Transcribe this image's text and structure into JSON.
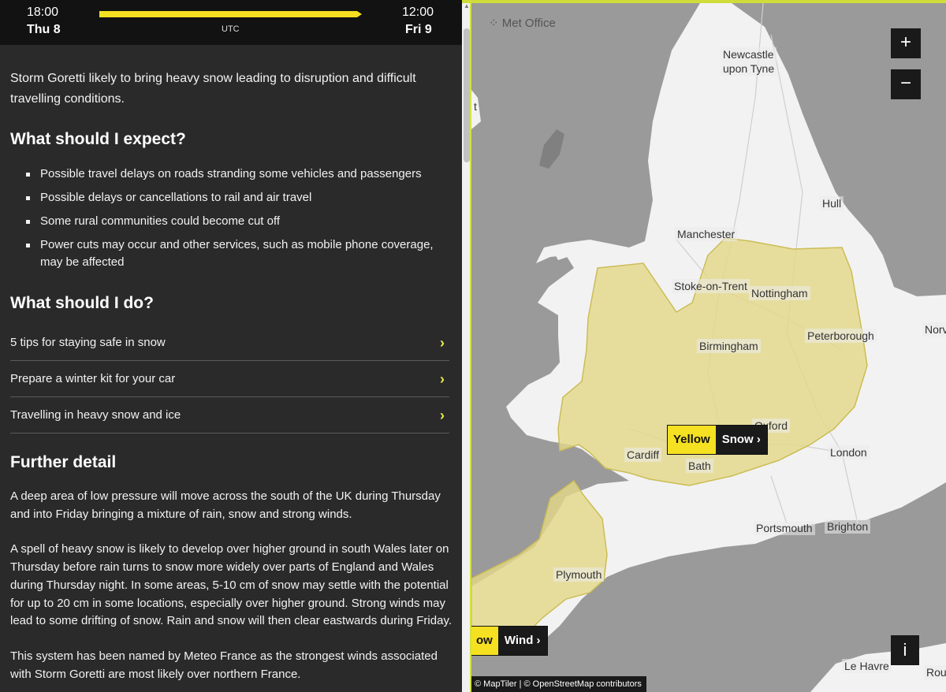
{
  "timebar": {
    "start_time": "18:00",
    "start_day": "Thu 8",
    "end_time": "12:00",
    "end_day": "Fri 9",
    "timezone": "UTC",
    "accent_color": "#f5e021"
  },
  "warning": {
    "intro": "Storm Goretti likely to bring heavy snow leading to disruption and difficult travelling conditions.",
    "expect_heading": "What should I expect?",
    "expect_items": [
      "Possible travel delays on roads stranding some vehicles and passengers",
      "Possible delays or cancellations to rail and air travel",
      "Some rural communities could become cut off",
      "Power cuts may occur and other services, such as mobile phone coverage, may be affected"
    ],
    "do_heading": "What should I do?",
    "do_links": [
      "5 tips for staying safe in snow",
      "Prepare a winter kit for your car",
      "Travelling in heavy snow and ice"
    ],
    "further_heading": "Further detail",
    "further_paragraphs": [
      "A deep area of low pressure will move across the south of the UK during Thursday and into Friday bringing a mixture of rain, snow and strong winds.",
      "A spell of heavy snow is likely to develop over higher ground in south Wales later on Thursday before rain turns to snow more widely over parts of England and Wales during Thursday night. In some areas, 5-10 cm of snow may settle with the potential for up to 20 cm in some locations, especially over higher ground. Strong winds may lead to some drifting of snow. Rain and snow will then clear eastwards during Friday.",
      "This system has been named by Meteo France as the strongest winds associated with Storm Goretti are most likely over northern France."
    ]
  },
  "map": {
    "logo": "Met Office",
    "zoom_in": "+",
    "zoom_out": "−",
    "info": "i",
    "attribution": "© MapTiler | © OpenStreetMap contributors",
    "cities": {
      "newcastle": "Newcastle\nupon Tyne",
      "hull": "Hull",
      "manchester": "Manchester",
      "stoke": "Stoke-on-Trent",
      "nottingham": "Nottingham",
      "birmingham": "Birmingham",
      "peterborough": "Peterborough",
      "norwich": "Norv",
      "oxford": "Oxford",
      "cardiff": "Cardiff",
      "bath": "Bath",
      "london": "London",
      "portsmouth": "Portsmouth",
      "brighton": "Brighton",
      "plymouth": "Plymouth",
      "lehavre": "Le Havre",
      "rouen": "Rouen",
      "edge_t": "t"
    },
    "warnings": [
      {
        "level": "Yellow",
        "type": "Snow"
      },
      {
        "level": "ow",
        "type": "Wind"
      }
    ],
    "colors": {
      "sea": "#9a9a9a",
      "land": "#f2f2f2",
      "warning_fill": "#e8dc8c"
    }
  }
}
